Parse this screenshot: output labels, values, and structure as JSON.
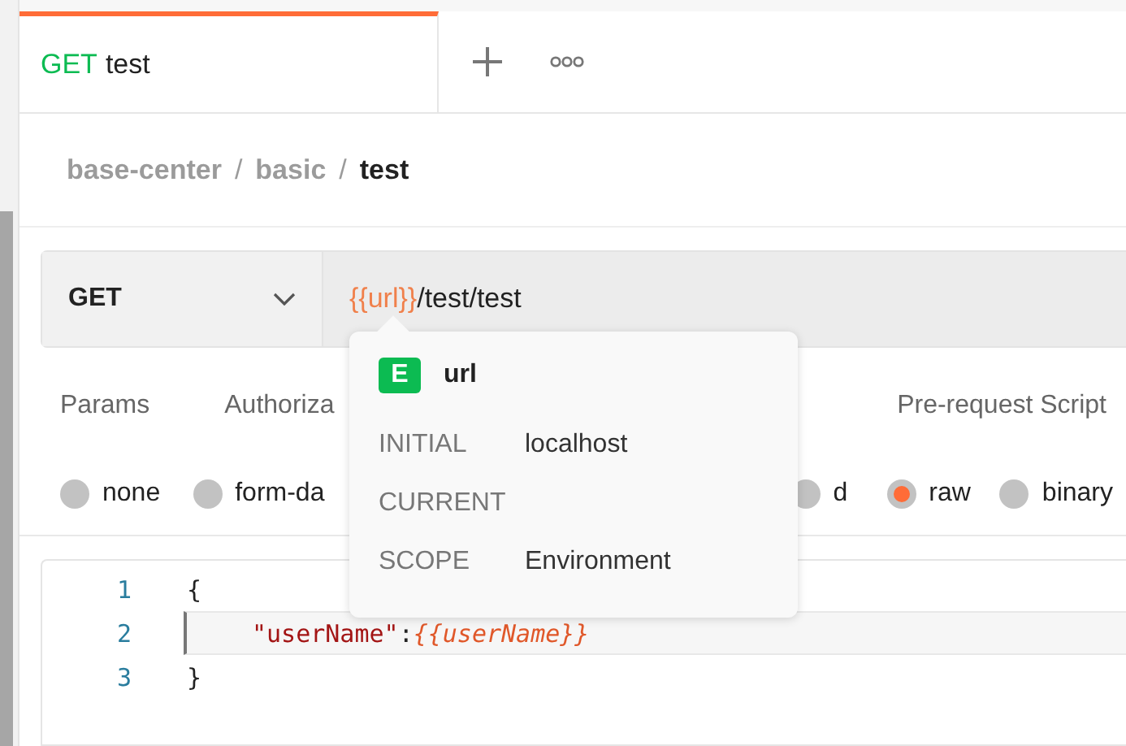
{
  "tabs": [
    {
      "method": "GET",
      "title": "test",
      "selected": true
    }
  ],
  "breadcrumb": {
    "separator": "/",
    "items": [
      "base-center",
      "basic",
      "test"
    ]
  },
  "request": {
    "method": "GET",
    "url_variable": "{{url}}",
    "url_path": "/test/test"
  },
  "request_tabs": [
    "Params",
    "Authoriza",
    "Pre-request Script"
  ],
  "body_types": [
    {
      "label": "none",
      "selected": false
    },
    {
      "label": "form-da",
      "selected": false
    },
    {
      "label": "d",
      "selected": false
    },
    {
      "label": "raw",
      "selected": true
    },
    {
      "label": "binary",
      "selected": false
    }
  ],
  "editor": {
    "lines": [
      {
        "number": "1",
        "highlighted": false,
        "tokens": [
          {
            "kind": "punct",
            "text": "{"
          }
        ]
      },
      {
        "number": "2",
        "highlighted": true,
        "tokens": [
          {
            "kind": "key",
            "text": "\"userName\""
          },
          {
            "kind": "punct",
            "text": ":"
          },
          {
            "kind": "variable",
            "text": "{{userName}}"
          }
        ]
      },
      {
        "number": "3",
        "highlighted": false,
        "tokens": [
          {
            "kind": "punct",
            "text": "}"
          }
        ]
      }
    ]
  },
  "variable_popup": {
    "badge": "E",
    "name": "url",
    "rows": [
      {
        "label": "INITIAL",
        "value": "localhost"
      },
      {
        "label": "CURRENT"
      },
      {
        "label": "SCOPE",
        "value": "Environment"
      }
    ]
  }
}
